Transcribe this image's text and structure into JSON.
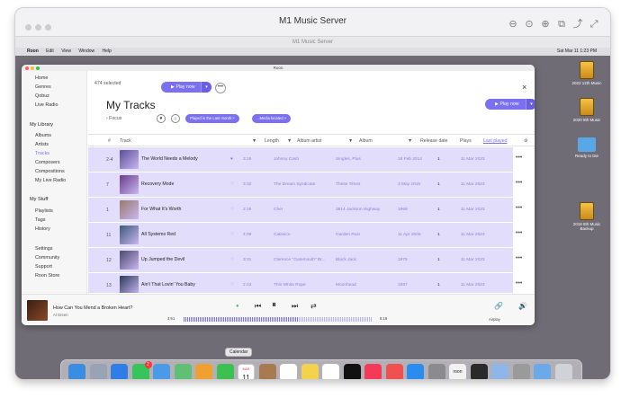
{
  "outer_window": {
    "title": "M1 Music Server",
    "subtitle": "M1 Music Server"
  },
  "mac_menubar": {
    "items": [
      "Roon",
      "Edit",
      "View",
      "Window",
      "Help"
    ],
    "clock": "Sat Mar 11 1:23 PM"
  },
  "desktop_icons": [
    {
      "label": "2022 12th Music"
    },
    {
      "label": "2020 8th Music"
    },
    {
      "label": "Ready to Die"
    },
    {
      "label": "2018 8th Music Backup"
    }
  ],
  "roon": {
    "window_title": "Roon",
    "sidebar": {
      "top_items": [
        "Home",
        "Genres",
        "Qobuz",
        "Live Radio"
      ],
      "library_header": "My Library",
      "library_items": [
        "Albums",
        "Artists",
        "Tracks",
        "Composers",
        "Compositions",
        "My Live Radio"
      ],
      "stuff_header": "My Stuff",
      "stuff_items": [
        "Playlists",
        "Tags",
        "History"
      ],
      "bottom_items": [
        "Settings",
        "Community",
        "Support",
        "Roon Store"
      ],
      "active_item": "Tracks"
    },
    "toolbar": {
      "selected": "474 selected",
      "play_now": "Play now",
      "more": "•••",
      "close": "×"
    },
    "page_title": "My Tracks",
    "focus": "Focus",
    "filter_chips": [
      "Played in the Last month",
      "...Media located"
    ],
    "play_now_main": "Play now",
    "columns": {
      "num": "#",
      "track": "Track",
      "length": "Length",
      "album_artist": "Album artist",
      "album": "Album",
      "release_date": "Release date",
      "plays": "Plays",
      "last_played": "Last played"
    },
    "tracks": [
      {
        "num": "2-4",
        "title": "The World Needs a Melody",
        "length": "3:19",
        "artist": "Johnny Cash",
        "album": "Singles, Plus",
        "date": "18 Feb 2014",
        "plays": "1",
        "last": "11 Mar 2023",
        "fav": true,
        "art_color": "#5b4e9a"
      },
      {
        "num": "7",
        "title": "Recovery Mode",
        "length": "3:32",
        "artist": "The Dream Syndicate",
        "album": "These Times",
        "date": "3 May 2019",
        "plays": "1",
        "last": "11 Mar 2023",
        "fav": false,
        "art_color": "#6a3c8a"
      },
      {
        "num": "1",
        "title": "For What It's Worth",
        "length": "2:19",
        "artist": "Cher",
        "album": "3614 Jackson Highway",
        "date": "1969",
        "plays": "1",
        "last": "11 Mar 2023",
        "fav": false,
        "art_color": "#9a7a6a"
      },
      {
        "num": "11",
        "title": "All Systems Red",
        "length": "4:09",
        "artist": "Calexico",
        "album": "Garden Ruin",
        "date": "11 Apr 2006",
        "plays": "1",
        "last": "11 Mar 2023",
        "fav": false,
        "art_color": "#3c5a7a"
      },
      {
        "num": "12",
        "title": "Up Jumped the Devil",
        "length": "3:31",
        "artist": "Clarence \"Gatemouth\" Br...",
        "album": "Black Jack",
        "date": "1975",
        "plays": "1",
        "last": "11 Mar 2023",
        "fav": false,
        "art_color": "#4a4a6a"
      },
      {
        "num": "13",
        "title": "Ain't That Lovin' You Baby",
        "length": "2:43",
        "artist": "Thin White Rope",
        "album": "Moonhead",
        "date": "1987",
        "plays": "1",
        "last": "11 Mar 2023",
        "fav": false,
        "art_color": "#2a3a5a"
      }
    ],
    "player": {
      "title": "How Can You Mend a Broken Heart?",
      "artist": "Al Green",
      "elapsed": "3:51",
      "total": "6:18",
      "progress": 0.61,
      "zone": "Airplay"
    }
  },
  "dock": {
    "tooltip": "Calendar",
    "calendar_month": "MAR",
    "calendar_day": "11",
    "badge": "2",
    "icons": [
      "finder-icon",
      "launchpad-icon",
      "safari-icon",
      "messages-icon",
      "mail-icon",
      "maps-icon",
      "photos-icon",
      "facetime-icon",
      "calendar-icon",
      "contacts-icon",
      "reminders-icon",
      "notes-icon",
      "freeform-icon",
      "tv-icon",
      "music-icon",
      "news-icon",
      "appstore-icon",
      "settings-icon",
      "roon-icon",
      "quicktime-icon",
      "preview-icon",
      "screenshot-icon",
      "downloads-folder-icon",
      "trash-icon"
    ]
  }
}
